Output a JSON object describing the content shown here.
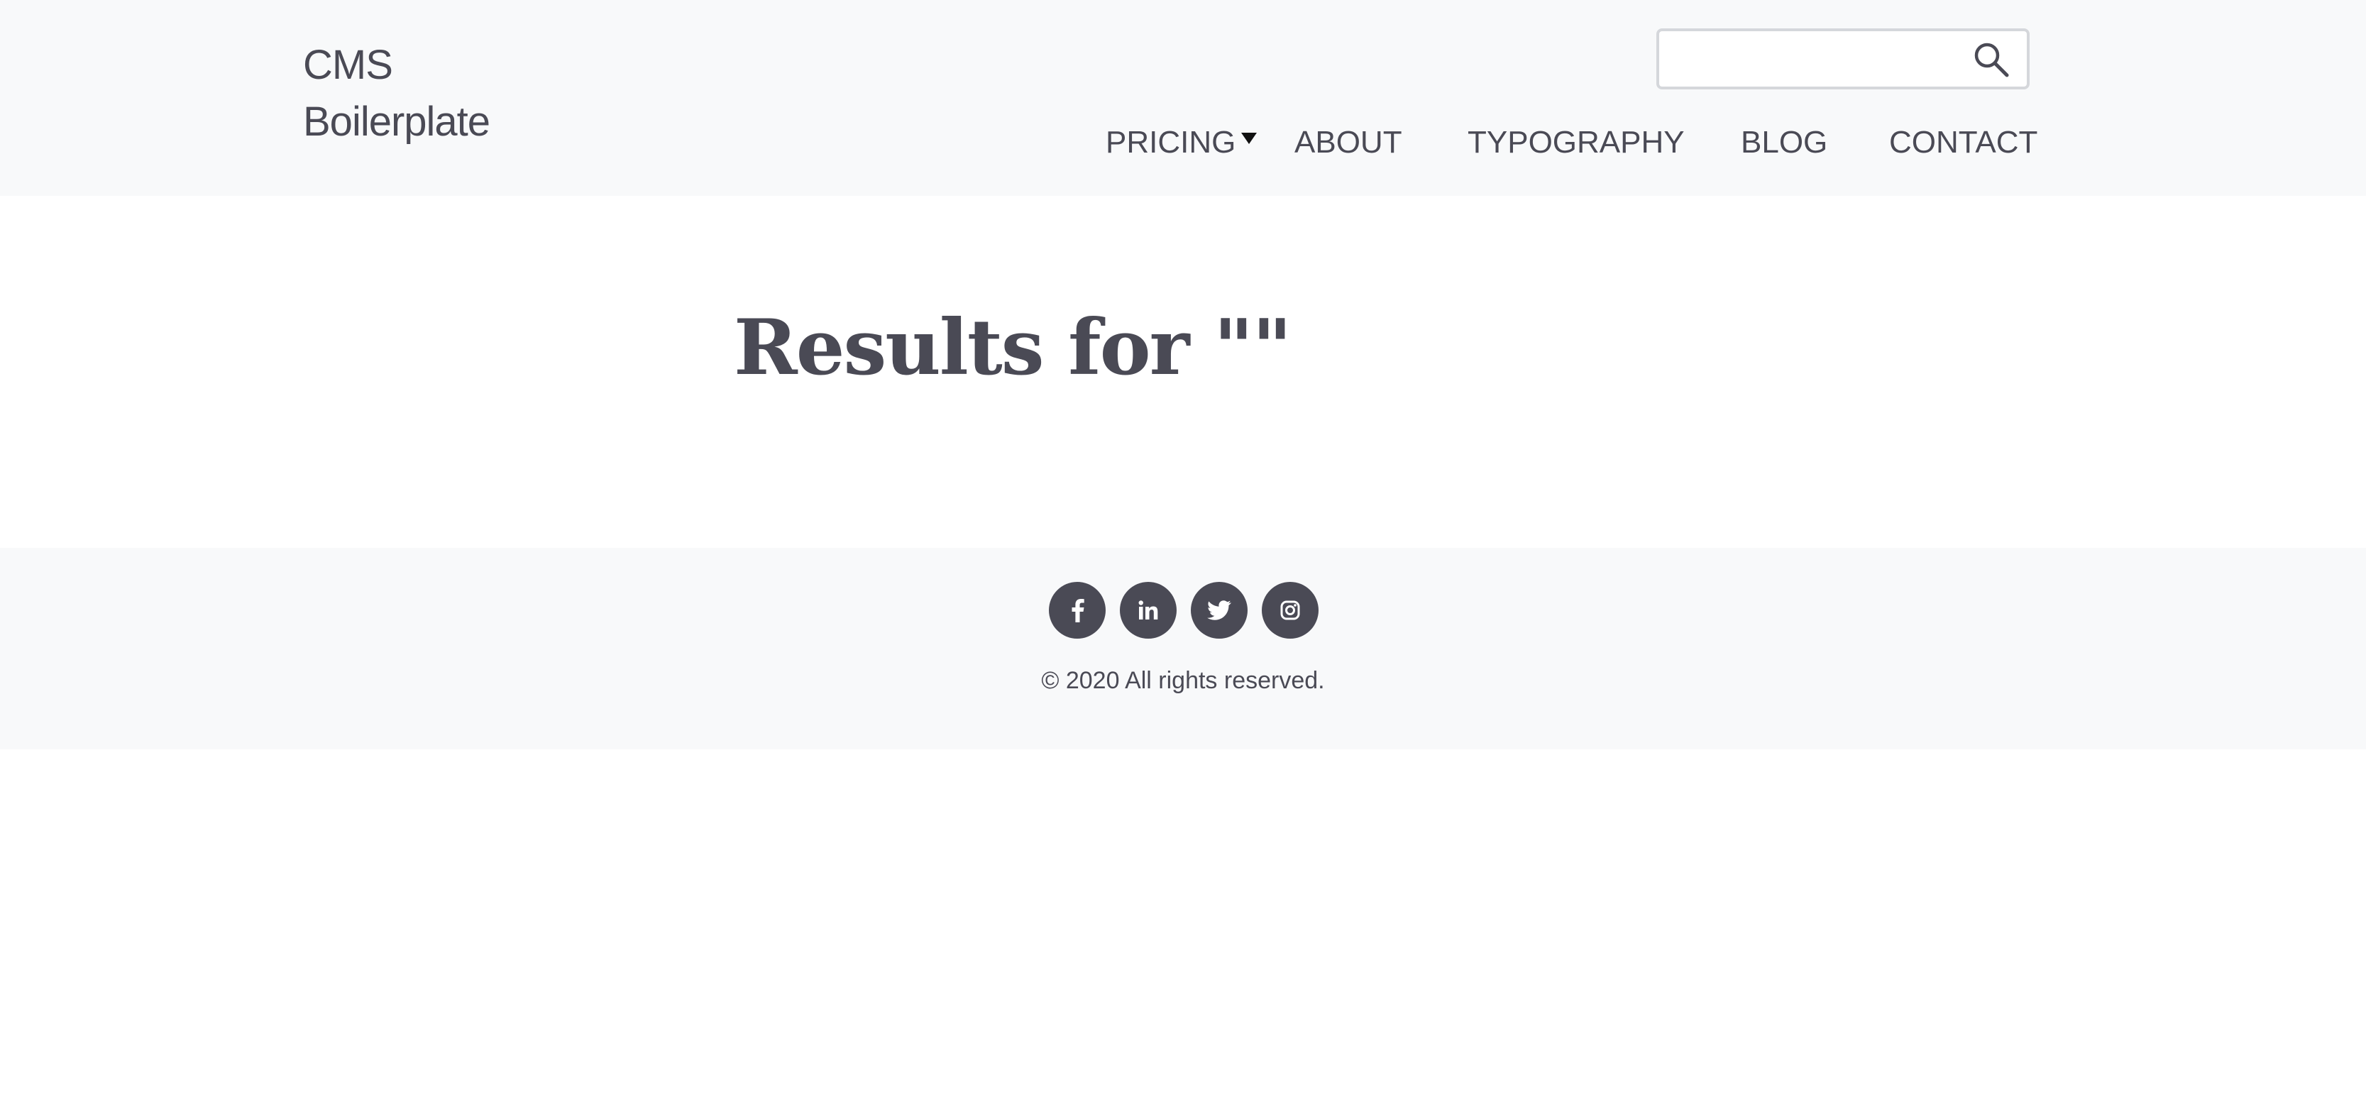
{
  "header": {
    "brand_line1": "CMS",
    "brand_line2": "Boilerplate",
    "search": {
      "value": "",
      "placeholder": ""
    },
    "nav": {
      "pricing": "PRICING",
      "about": "ABOUT",
      "typography": "TYPOGRAPHY",
      "blog": "BLOG",
      "contact": "CONTACT"
    }
  },
  "main": {
    "title": "Results for \"\""
  },
  "footer": {
    "social_icons": [
      "facebook-icon",
      "linkedin-icon",
      "twitter-icon",
      "instagram-icon"
    ],
    "copyright": "© 2020 All rights reserved."
  },
  "colors": {
    "header_bg": "#f8f9fa",
    "text": "#4a4a55",
    "icon_circle": "#4a4a55",
    "body_bg": "#ffffff"
  }
}
